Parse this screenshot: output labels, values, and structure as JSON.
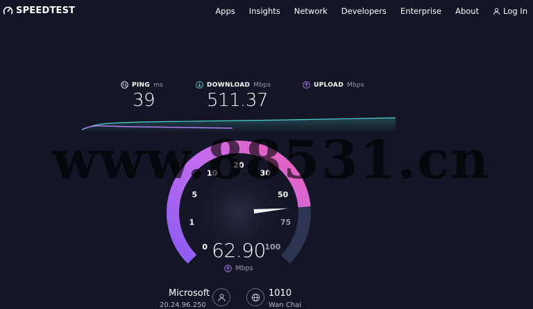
{
  "brand": {
    "name": "SPEEDTEST"
  },
  "nav": {
    "items": [
      "Apps",
      "Insights",
      "Network",
      "Developers",
      "Enterprise",
      "About"
    ],
    "login_label": "Log In"
  },
  "results": {
    "ping": {
      "label": "PING",
      "unit": "ms",
      "value": "39"
    },
    "download": {
      "label": "DOWNLOAD",
      "unit": "Mbps",
      "value": "511.37"
    },
    "upload": {
      "label": "UPLOAD",
      "unit": "Mbps",
      "value": ""
    }
  },
  "gauge": {
    "ticks": [
      "0",
      "1",
      "5",
      "10",
      "20",
      "30",
      "50",
      "75",
      "100"
    ],
    "current_value": "62.90",
    "unit": "Mbps",
    "colors": {
      "track": "#2f3452",
      "fill_start": "#8a5cf0",
      "fill_mid": "#c46cf0",
      "fill_end": "#f05fb0",
      "needle": "#ffffff"
    }
  },
  "server": {
    "isp": "Microsoft",
    "ip": "20.24.96.250",
    "host": "1010",
    "location": "Wan Chai"
  },
  "watermark": "www.88531.cn",
  "colors": {
    "background": "#141526",
    "download_accent": "#4fd6d0",
    "upload_accent": "#b07ef2"
  }
}
